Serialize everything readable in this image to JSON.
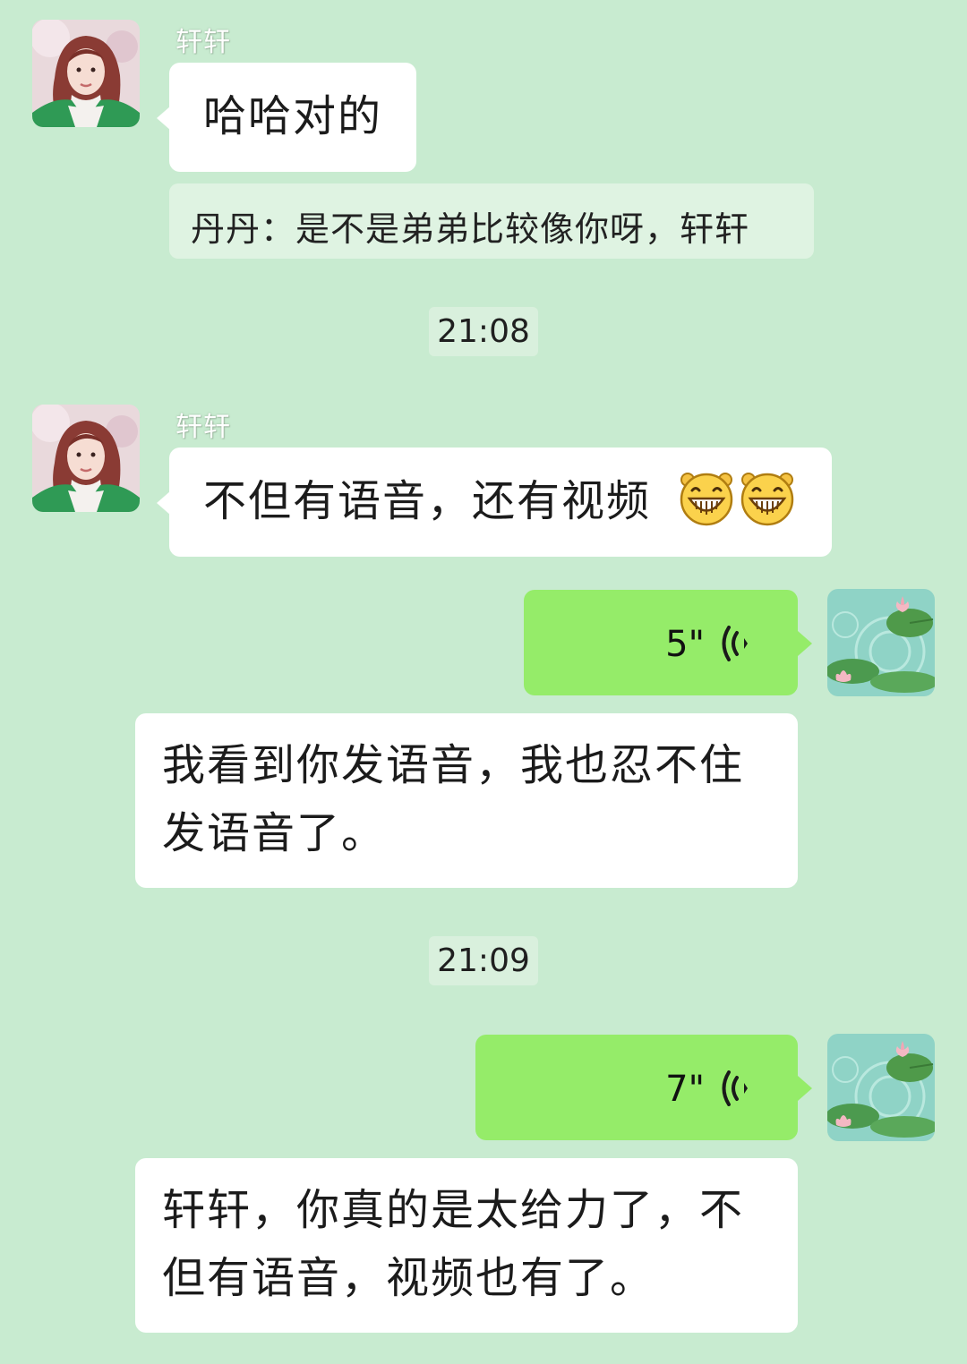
{
  "messages": [
    {
      "sender": "轩轩",
      "text": "哈哈对的"
    },
    {
      "sender": "轩轩",
      "text": "不但有语音，还有视频"
    }
  ],
  "quote": {
    "text": "丹丹：是不是弟弟比较像你呀，轩轩"
  },
  "timestamps": [
    "21:08",
    "21:09"
  ],
  "voice_messages": [
    {
      "duration": "5\""
    },
    {
      "duration": "7\""
    }
  ],
  "translations": [
    {
      "line1": "我看到你发语音，我也忍不住",
      "line2": "发语音了。"
    },
    {
      "line1": "轩轩，你真的是太给力了，不",
      "line2": "但有语音，视频也有了。"
    }
  ],
  "icons": {
    "emoji": "grinning-face-icon",
    "voice": "voice-wave-icon"
  },
  "colors": {
    "background": "#c8ebd0",
    "voice_bubble": "#95ec69",
    "bubble": "#ffffff"
  }
}
